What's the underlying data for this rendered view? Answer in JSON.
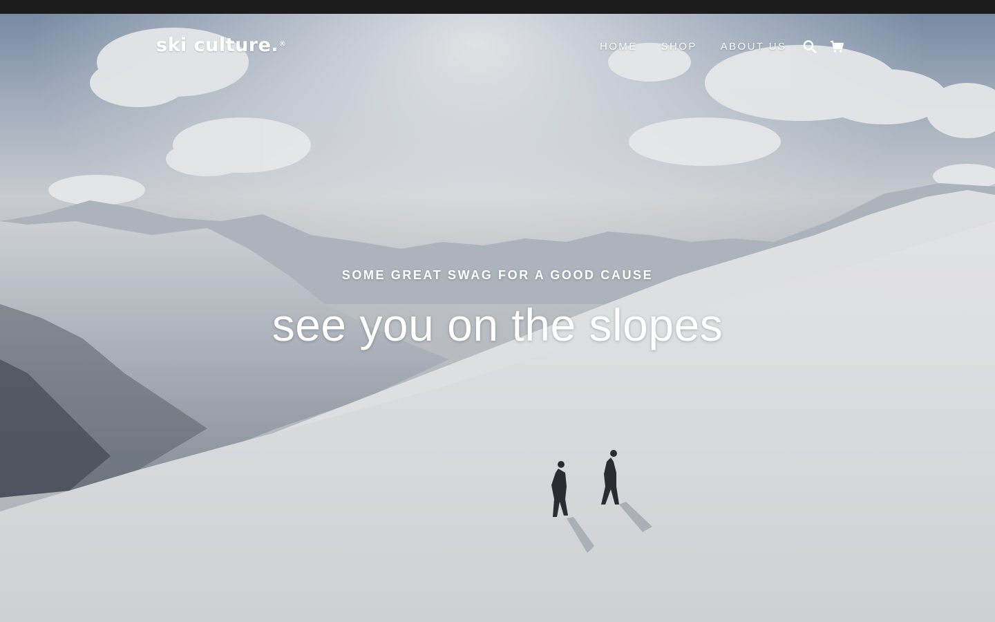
{
  "header": {
    "logo_text": "ski culture.",
    "logo_mark": "®",
    "nav": [
      {
        "label": "HOME"
      },
      {
        "label": "SHOP"
      },
      {
        "label": "ABOUT US"
      }
    ],
    "icons": [
      "search-icon",
      "cart-icon"
    ]
  },
  "hero": {
    "subtitle": "SOME GREAT SWAG FOR A GOOD CAUSE",
    "title": "see you on the slopes",
    "image": "snowy-mountain-with-two-ski-tourers"
  },
  "colors": {
    "topbar": "#1c1c1c",
    "text": "#ffffff"
  }
}
